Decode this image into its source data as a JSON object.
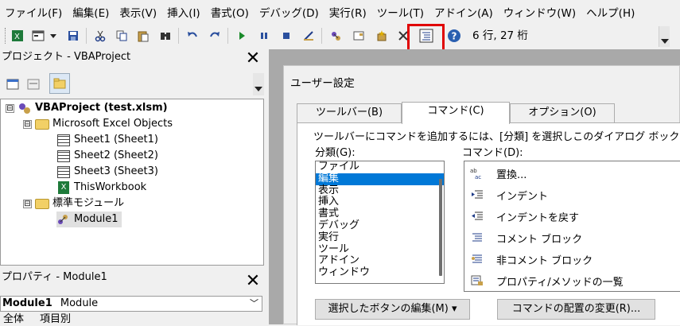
{
  "menubar": [
    "ファイル(F)",
    "編集(E)",
    "表示(V)",
    "挿入(I)",
    "書式(O)",
    "デバッグ(D)",
    "実行(R)",
    "ツール(T)",
    "アドイン(A)",
    "ウィンドウ(W)",
    "ヘルプ(H)"
  ],
  "toolbar": {
    "icons": [
      "view-excel-icon",
      "insert-module-icon",
      "dropdown-arrow-icon",
      "save-icon",
      "cut-icon",
      "copy-icon",
      "paste-icon",
      "find-icon",
      "undo-icon",
      "redo-icon",
      "run-icon",
      "break-icon",
      "reset-icon",
      "design-mode-icon",
      "project-explorer-icon",
      "properties-window-icon",
      "object-browser-icon",
      "toolbox-icon",
      "comment-block-icon",
      "help-icon"
    ],
    "cursor_position": "6 行, 27 桁",
    "highlight_color": "#e00000"
  },
  "project_pane": {
    "title": "プロジェクト - VBAProject",
    "close_glyph": "✕",
    "tree": [
      {
        "label": "VBAProject (test.xlsm)",
        "bold": true,
        "expander": "⊟"
      },
      {
        "label": "Microsoft Excel Objects",
        "expander": "⊟"
      },
      {
        "label": "Sheet1 (Sheet1)"
      },
      {
        "label": "Sheet2 (Sheet2)"
      },
      {
        "label": "Sheet3 (Sheet3)"
      },
      {
        "label": "ThisWorkbook"
      },
      {
        "label": "標準モジュール",
        "expander": "⊟"
      },
      {
        "label": "Module1"
      }
    ]
  },
  "properties_pane": {
    "title": "プロパティ - Module1",
    "close_glyph": "✕",
    "object_name": "Module1",
    "object_type": "Module",
    "tabs": [
      "全体",
      "項目別"
    ]
  },
  "dialog": {
    "title": "ユーザー設定",
    "tabs": [
      "ツールバー(B)",
      "コマンド(C)",
      "オプション(O)"
    ],
    "active_tab": "コマンド(C)",
    "instruction": "ツールバーにコマンドを追加するには、[分類] を選択しこのダイアログ ボックスから",
    "category_label": "分類(G):",
    "command_label": "コマンド(D):",
    "categories": [
      "ファイル",
      "編集",
      "表示",
      "挿入",
      "書式",
      "デバッグ",
      "実行",
      "ツール",
      "アドイン",
      "ウィンドウ"
    ],
    "selected_category": "編集",
    "commands": [
      "置換...",
      "インデント",
      "インデントを戻す",
      "コメント ブロック",
      "非コメント ブロック",
      "プロパティ/メソッドの一覧"
    ],
    "edit_selection_button": "選択したボタンの編集(M) ▾",
    "rearrange_button": "コマンドの配置の変更(R)...",
    "selection_color": "#0078d7"
  }
}
